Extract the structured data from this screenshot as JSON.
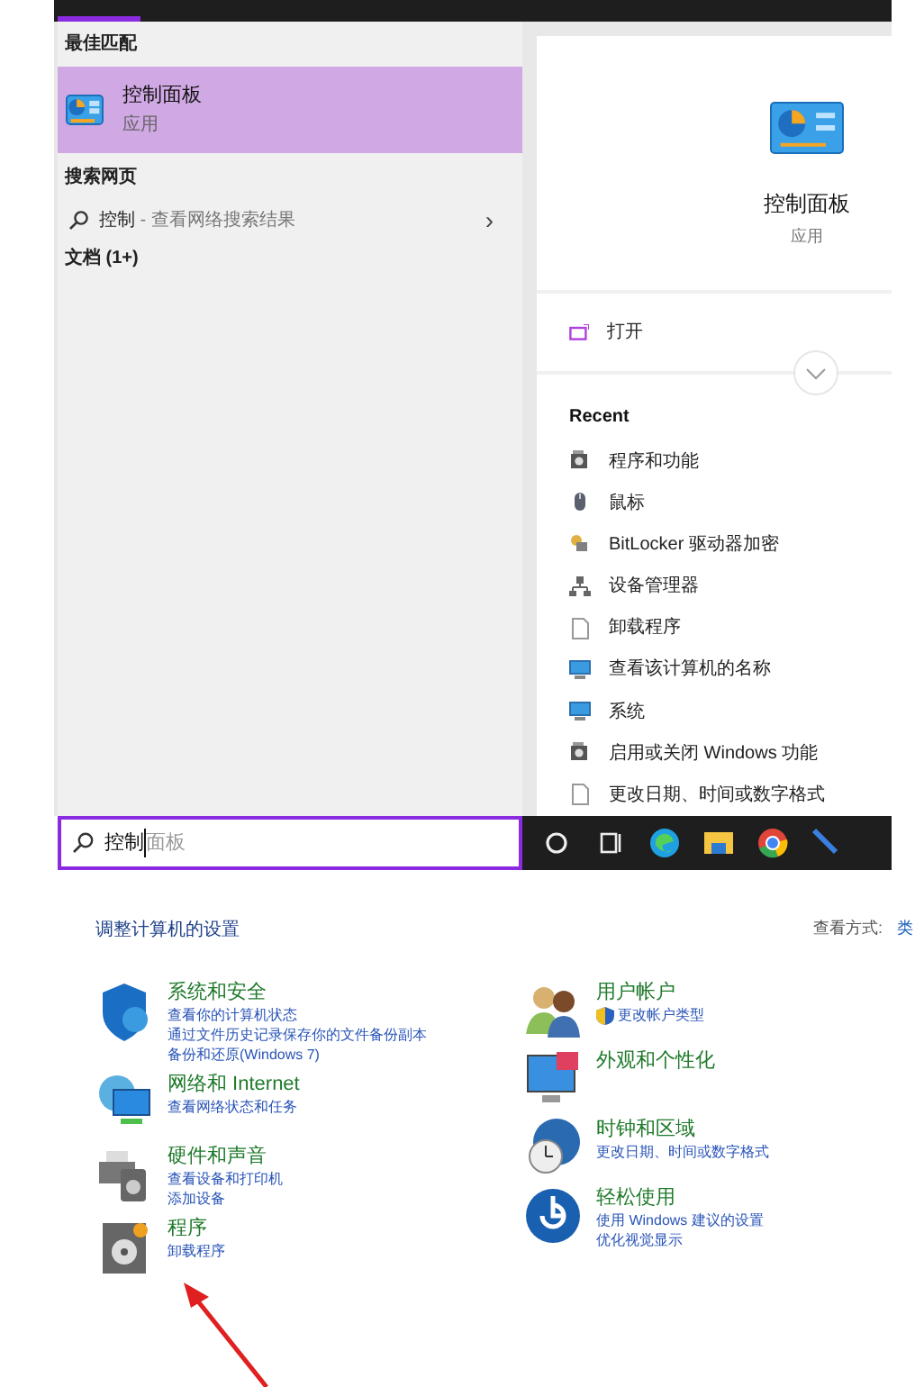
{
  "search_results": {
    "best_match_header": "最佳匹配",
    "best_match": {
      "title": "控制面板",
      "subtitle": "应用",
      "selected": true
    },
    "web_header": "搜索网页",
    "web_result": {
      "query": "控制",
      "suffix": " - 查看网络搜索结果",
      "arrow": "›"
    },
    "docs_header": "文档 (1+)"
  },
  "preview": {
    "title": "控制面板",
    "subtitle": "应用",
    "open_label": "打开",
    "recent_header": "Recent",
    "recent": [
      {
        "label": "程序和功能",
        "kind": "programs"
      },
      {
        "label": "鼠标",
        "kind": "mouse"
      },
      {
        "label": "BitLocker 驱动器加密",
        "kind": "bitlocker"
      },
      {
        "label": "设备管理器",
        "kind": "device"
      },
      {
        "label": "卸载程序",
        "kind": "document"
      },
      {
        "label": "查看该计算机的名称",
        "kind": "monitor"
      },
      {
        "label": "系统",
        "kind": "monitor"
      },
      {
        "label": "启用或关闭 Windows 功能",
        "kind": "programs"
      },
      {
        "label": "更改日期、时间或数字格式",
        "kind": "document"
      }
    ]
  },
  "search_box": {
    "typed": "控制",
    "suggestion": "面板"
  },
  "control_panel": {
    "heading": "调整计算机的设置",
    "view_by_label": "查看方式:",
    "view_by_value": "类",
    "left_categories": [
      {
        "title": "系统和安全",
        "kind": "shield",
        "links": [
          "查看你的计算机状态",
          "通过文件历史记录保存你的文件备份副本",
          "备份和还原(Windows 7)"
        ]
      },
      {
        "title": "网络和 Internet",
        "kind": "network",
        "links": [
          "查看网络状态和任务"
        ]
      },
      {
        "title": "硬件和声音",
        "kind": "hardware",
        "links": [
          "查看设备和打印机",
          "添加设备"
        ]
      },
      {
        "title": "程序",
        "kind": "programs",
        "links": [
          "卸载程序"
        ]
      }
    ],
    "right_categories": [
      {
        "title": "用户帐户",
        "kind": "users",
        "links": [
          "更改帐户类型"
        ],
        "shield_link": true
      },
      {
        "title": "外观和个性化",
        "kind": "appearance"
      },
      {
        "title": "时钟和区域",
        "kind": "clock",
        "links": [
          "更改日期、时间或数字格式"
        ]
      },
      {
        "title": "轻松使用",
        "kind": "ease",
        "links": [
          "使用 Windows 建议的设置",
          "优化视觉显示"
        ]
      }
    ]
  }
}
